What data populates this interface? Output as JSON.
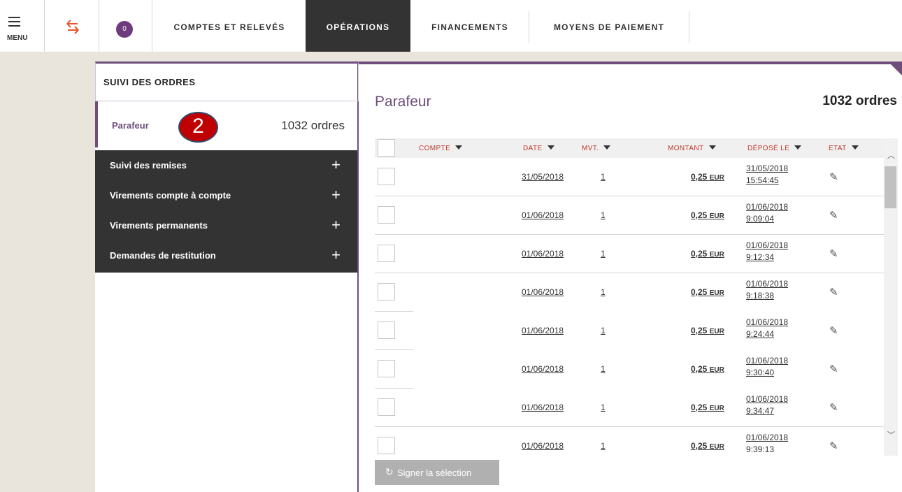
{
  "nav": {
    "menu_label": "MENU",
    "badge_count": "0",
    "tabs": [
      {
        "label": "COMPTES ET RELEVÉS"
      },
      {
        "label": "OPÉRATIONS"
      },
      {
        "label": "FINANCEMENTS"
      },
      {
        "label": "MOYENS DE PAIEMENT"
      }
    ],
    "active_tab": "OPÉRATIONS"
  },
  "sidebar": {
    "title": "SUIVI DES ORDRES",
    "selected": {
      "label": "Parafeur",
      "count": "1032 ordres"
    },
    "step_marker": "2",
    "items": [
      {
        "label": "Suivi des remises",
        "toggle": "+"
      },
      {
        "label": "Virements compte à compte",
        "toggle": "+"
      },
      {
        "label": "Virements permanents",
        "toggle": "+"
      },
      {
        "label": "Demandes de restitution",
        "toggle": "+"
      }
    ]
  },
  "main": {
    "title": "Parafeur",
    "count": "1032 ordres",
    "columns": {
      "compte": "COMPTE",
      "date": "DATE",
      "mvt": "MVT.",
      "montant": "MONTANT",
      "depose": "DÉPOSÉ LE",
      "etat": "ETAT"
    },
    "rows": [
      {
        "date": "31/05/2018",
        "mvt": "1",
        "amount": "0,25",
        "currency": "EUR",
        "dep_date": "31/05/2018",
        "dep_time": "15:54:45"
      },
      {
        "date": "01/06/2018",
        "mvt": "1",
        "amount": "0,25",
        "currency": "EUR",
        "dep_date": "01/06/2018",
        "dep_time": "9:09:04"
      },
      {
        "date": "01/06/2018",
        "mvt": "1",
        "amount": "0,25",
        "currency": "EUR",
        "dep_date": "01/06/2018",
        "dep_time": "9:12:34"
      },
      {
        "date": "01/06/2018",
        "mvt": "1",
        "amount": "0,25",
        "currency": "EUR",
        "dep_date": "01/06/2018",
        "dep_time": "9:18:38"
      },
      {
        "date": "01/06/2018",
        "mvt": "1",
        "amount": "0,25",
        "currency": "EUR",
        "dep_date": "01/06/2018",
        "dep_time": "9:24:44"
      },
      {
        "date": "01/06/2018",
        "mvt": "1",
        "amount": "0,25",
        "currency": "EUR",
        "dep_date": "01/06/2018",
        "dep_time": "9:30:40"
      },
      {
        "date": "01/06/2018",
        "mvt": "1",
        "amount": "0,25",
        "currency": "EUR",
        "dep_date": "01/06/2018",
        "dep_time": "9:34:47"
      },
      {
        "date": "01/06/2018",
        "mvt": "1",
        "amount": "0,25",
        "currency": "EUR",
        "dep_date": "01/06/2018",
        "dep_time": "9:39:13"
      }
    ],
    "sign_button": "Signer la sélection"
  },
  "colors": {
    "accent": "#6e4f7c",
    "dark": "#333333",
    "header_text": "#c0392b",
    "swap_icon": "#e4572e"
  },
  "icons": [
    "menu-icon",
    "swap-arrows-icon",
    "pencil-icon",
    "refresh-icon",
    "caret-down-icon",
    "plus-icon"
  ]
}
